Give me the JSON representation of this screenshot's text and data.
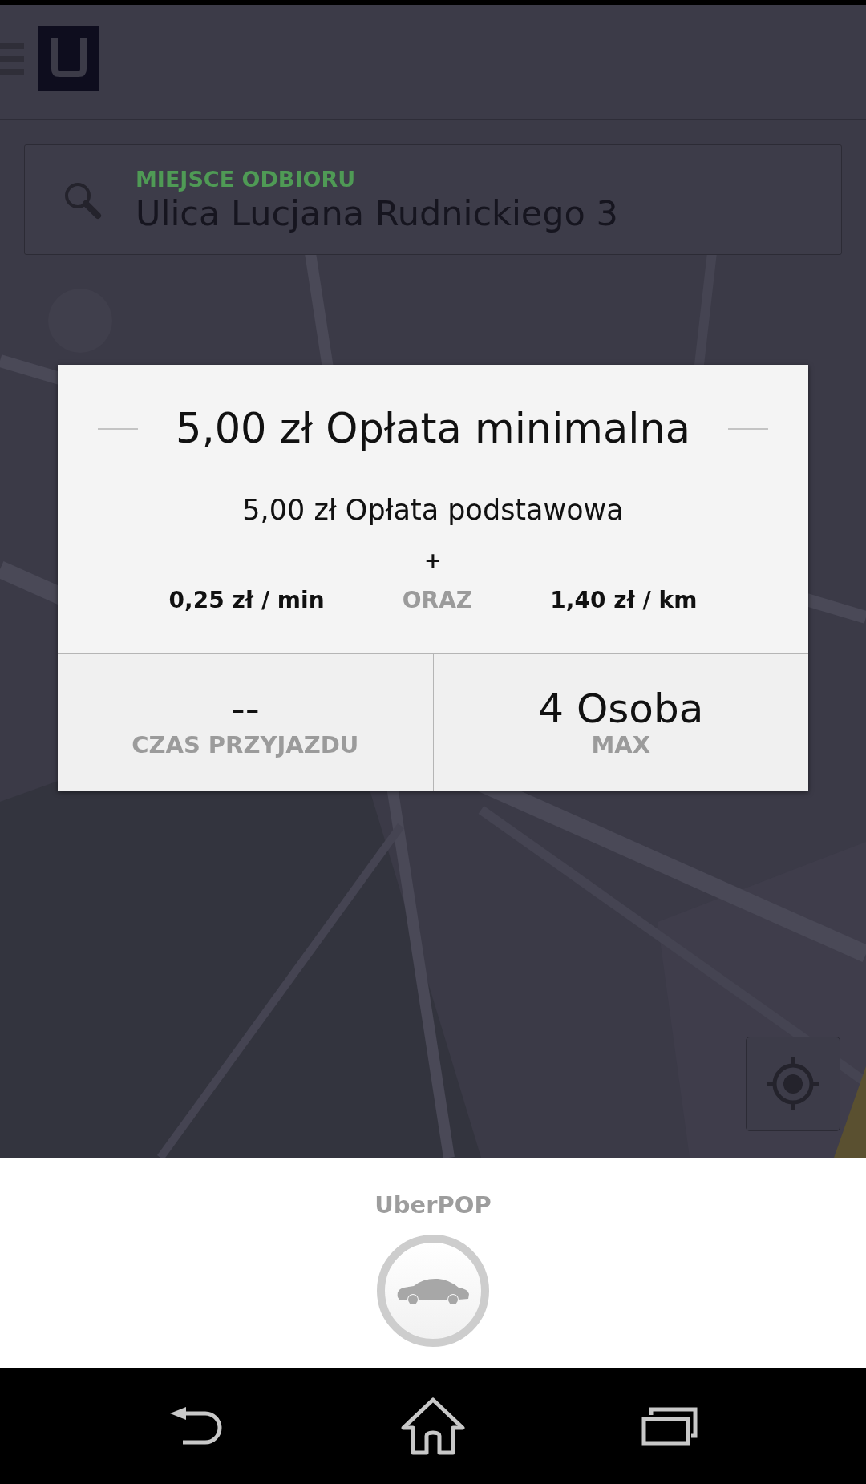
{
  "pickup": {
    "label": "MIEJSCE ODBIORU",
    "value": "Ulica Lucjana Rudnickiego 3"
  },
  "fare_card": {
    "title": "5,00 zł Opłata minimalna",
    "base_fare": "5,00 zł Opłata podstawowa",
    "plus": "+",
    "rates": [
      {
        "kind": "rate",
        "text": "0,25 zł / min"
      },
      {
        "kind": "connector",
        "text": "ORAZ"
      },
      {
        "kind": "rate",
        "text": "1,40 zł / km"
      }
    ],
    "stats": [
      {
        "value": "--",
        "label": "CZAS PRZYJAZDU"
      },
      {
        "value": "4 Osoba",
        "label": "MAX"
      }
    ]
  },
  "vehicle": {
    "name": "UberPOP"
  }
}
